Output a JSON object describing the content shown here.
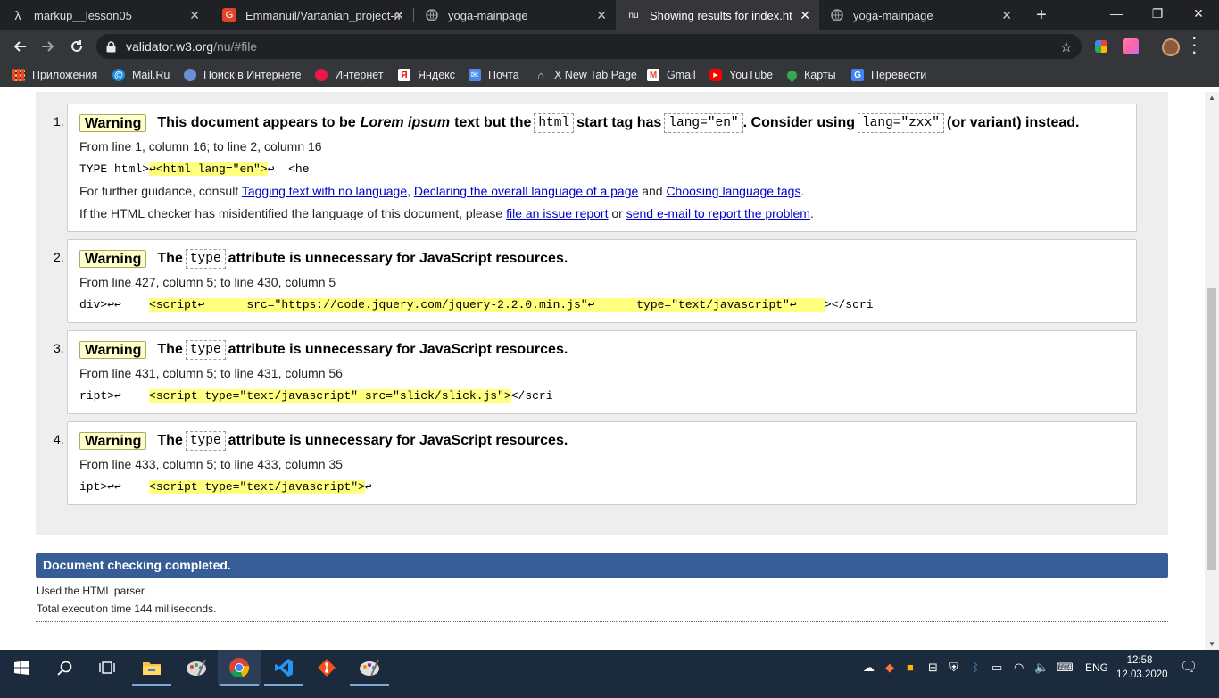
{
  "browser": {
    "tabs": [
      {
        "title": "markup__lesson05",
        "favicon": "lambda-icon",
        "active": false
      },
      {
        "title": "Emmanuil/Vartanian_project-m",
        "favicon": "gitlab-icon",
        "active": false
      },
      {
        "title": "yoga-mainpage",
        "favicon": "globe-icon",
        "active": false
      },
      {
        "title": "Showing results for index.html",
        "favicon": "nu-icon",
        "favicon_text": "nu",
        "active": true
      },
      {
        "title": "yoga-mainpage",
        "favicon": "globe-icon",
        "active": false
      }
    ],
    "close_glyph": "✕",
    "new_tab_glyph": "+",
    "window_controls": {
      "minimize": "—",
      "maximize": "❐",
      "close": "✕"
    },
    "address": {
      "host": "validator.w3.org",
      "path": "/nu/#file"
    },
    "bookmarks": [
      {
        "label": "Приложения",
        "icon": "apps-grid-icon",
        "color": "#e94235"
      },
      {
        "label": "Mail.Ru",
        "icon": "mailru-icon",
        "color": "#168de2"
      },
      {
        "label": "Поиск в Интернете",
        "icon": "search-web-icon",
        "color": "#6a8fd6"
      },
      {
        "label": "Интернет",
        "icon": "internet-icon",
        "color": "#e8194a"
      },
      {
        "label": "Яндекс",
        "icon": "yandex-icon",
        "color": "#ff0000"
      },
      {
        "label": "Почта",
        "icon": "mail-icon",
        "color": "#4d8be8"
      },
      {
        "label": "X New Tab Page",
        "icon": "home-icon",
        "color": "#dadce0"
      },
      {
        "label": "Gmail",
        "icon": "gmail-icon",
        "color": "#ea4335"
      },
      {
        "label": "YouTube",
        "icon": "youtube-icon",
        "color": "#ff0000"
      },
      {
        "label": "Карты",
        "icon": "maps-pin-icon",
        "color": "#34a853"
      },
      {
        "label": "Перевести",
        "icon": "translate-icon",
        "color": "#4285f4"
      }
    ]
  },
  "messages": [
    {
      "number": "1.",
      "badge": "Warning",
      "head_parts": {
        "a": "This document appears to be",
        "em": "Lorem ipsum",
        "b": "text but the",
        "code1": "html",
        "c": "start tag has",
        "code2": "lang=\"en\"",
        "d": ". Consider using",
        "code3": "lang=\"zxx\"",
        "e": "(or variant) instead."
      },
      "location": "From line 1, column 16; to line 2, column 16",
      "extract": {
        "pre": "TYPE html>",
        "hl": "↩<html lang=\"en\">",
        "post": "↩  <he"
      },
      "guidance": {
        "prefix": "For further guidance, consult",
        "link1": "Tagging text with no language",
        "sep1": ",",
        "link2": "Declaring the overall language of a page",
        "sep2": "and",
        "link3": "Choosing language tags",
        "end": "."
      },
      "issue": {
        "prefix": "If the HTML checker has misidentified the language of this document, please",
        "link1": "file an issue report",
        "sep": "or",
        "link2": "send e-mail to report the problem",
        "end": "."
      }
    },
    {
      "number": "2.",
      "badge": "Warning",
      "head_parts": {
        "a": "The",
        "code1": "type",
        "b": "attribute is unnecessary for JavaScript resources."
      },
      "location": "From line 427, column 5; to line 430, column 5",
      "extract": {
        "pre": "div>↩↩    ",
        "hl": "<script↩      src=\"https://code.jquery.com/jquery-2.2.0.min.js\"↩      type=\"text/javascript\"↩    ",
        "post": "></scri"
      }
    },
    {
      "number": "3.",
      "badge": "Warning",
      "head_parts": {
        "a": "The",
        "code1": "type",
        "b": "attribute is unnecessary for JavaScript resources."
      },
      "location": "From line 431, column 5; to line 431, column 56",
      "extract": {
        "pre": "ript>↩    ",
        "hl": "<script type=\"text/javascript\" src=\"slick/slick.js\">",
        "post": "</scri"
      }
    },
    {
      "number": "4.",
      "badge": "Warning",
      "head_parts": {
        "a": "The",
        "code1": "type",
        "b": "attribute is unnecessary for JavaScript resources."
      },
      "location": "From line 433, column 5; to line 433, column 35",
      "extract": {
        "pre": "ipt>↩↩    ",
        "hl": "<script type=\"text/javascript\">",
        "post": "↩"
      }
    }
  ],
  "status": {
    "completed": "Document checking completed.",
    "parser": "Used the HTML parser.",
    "timing": "Total execution time 144 milliseconds."
  },
  "taskbar": {
    "apps": [
      "start-icon",
      "search-icon",
      "task-view-icon",
      "file-explorer-icon",
      "paint-icon",
      "chrome-icon",
      "vscode-icon",
      "git-icon",
      "paint-alt-icon"
    ],
    "language": "ENG",
    "time": "12:58",
    "date": "12.03.2020"
  }
}
